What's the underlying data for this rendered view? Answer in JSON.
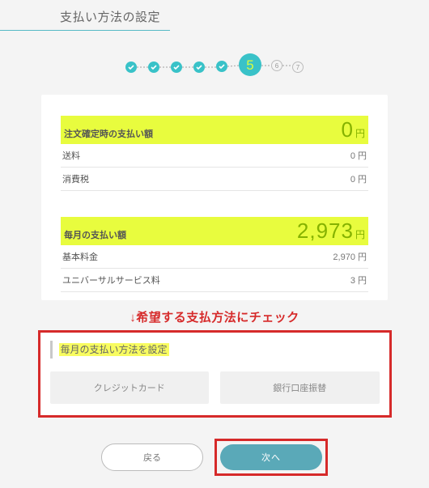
{
  "title": "支払い方法の設定",
  "progress": {
    "total": 7,
    "current": 5
  },
  "summary": {
    "order": {
      "label": "注文確定時の支払い額",
      "value": "0",
      "unit": "円"
    },
    "shipping": {
      "label": "送料",
      "value": "0 円"
    },
    "tax": {
      "label": "消費税",
      "value": "0 円"
    },
    "monthly": {
      "label": "毎月の支払い額",
      "value": "2,973",
      "unit": "円"
    },
    "base": {
      "label": "基本料金",
      "value": "2,970 円"
    },
    "usf": {
      "label": "ユニバーサルサービス料",
      "value": "3 円"
    }
  },
  "annotation": "↓希望する支払方法にチェック",
  "method": {
    "heading": "毎月の支払い方法を設定",
    "options": {
      "credit": "クレジットカード",
      "bank": "銀行口座振替"
    }
  },
  "actions": {
    "back": "戻る",
    "next": "次へ"
  }
}
